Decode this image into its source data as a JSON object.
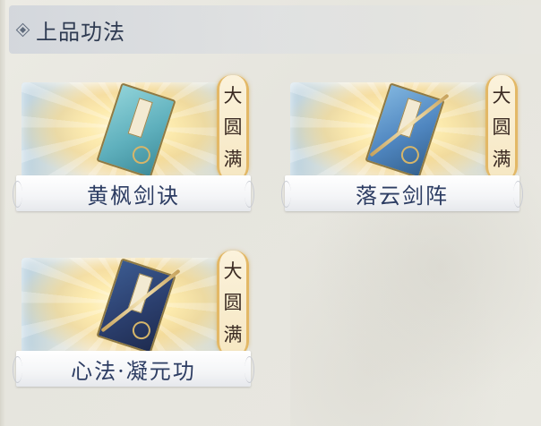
{
  "header": {
    "title": "上品功法",
    "icon": "diamond-icon"
  },
  "badge": [
    "大",
    "圆",
    "满"
  ],
  "cards": [
    {
      "name": "黄枫剑诀",
      "art": "jade-book"
    },
    {
      "name": "落云剑阵",
      "art": "blue-book"
    },
    {
      "name": "心法·凝元功",
      "art": "navy-book"
    }
  ]
}
